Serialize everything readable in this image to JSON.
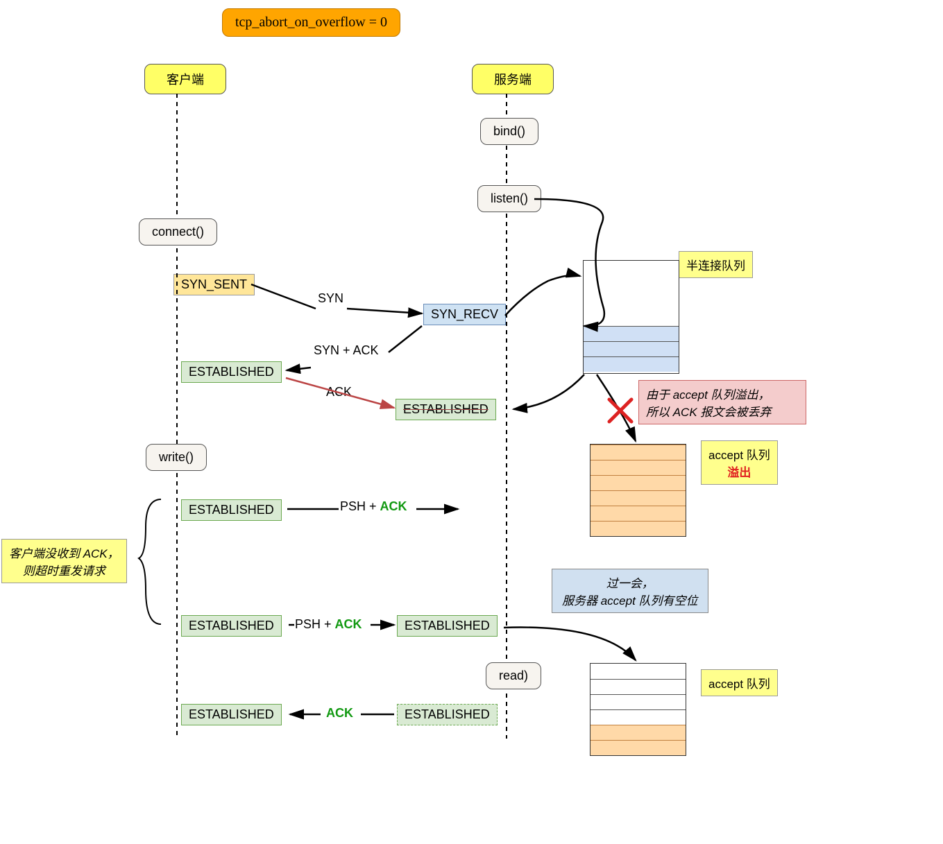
{
  "title": "tcp_abort_on_overflow = 0",
  "client": "客户端",
  "server": "服务端",
  "calls": {
    "bind": "bind()",
    "listen": "listen()",
    "connect": "connect()",
    "write": "write()",
    "read": "read)"
  },
  "states": {
    "syn_sent": "SYN_SENT",
    "syn_recv": "SYN_RECV",
    "est_client1": "ESTABLISHED",
    "est_server_strike": "ESTABLISHED",
    "est_psh1": "ESTABLISHED",
    "est_psh2_client": "ESTABLISHED",
    "est_psh2_server": "ESTABLISHED",
    "est_ack_client": "ESTABLISHED",
    "est_ack_server": "ESTABLISHED"
  },
  "arrows": {
    "syn": "SYN",
    "synack": "SYN + ACK",
    "ack": "ACK",
    "psh1_a": "PSH + ",
    "psh1_b": "ACK",
    "psh2_a": "PSH + ",
    "psh2_b": "ACK",
    "ack_back": "ACK"
  },
  "notes": {
    "half_queue": "半连接队列",
    "drop1": "由于 accept 队列溢出，",
    "drop2": "所以 ACK 报文会被丢弃",
    "accept_queue_label": "accept 队列",
    "overflow": "溢出",
    "retry1": "客户端没收到 ACK，",
    "retry2": "则超时重发请求",
    "wait1": "过一会，",
    "wait2": "服务器 accept 队列有空位",
    "accept_queue2": "accept 队列"
  }
}
